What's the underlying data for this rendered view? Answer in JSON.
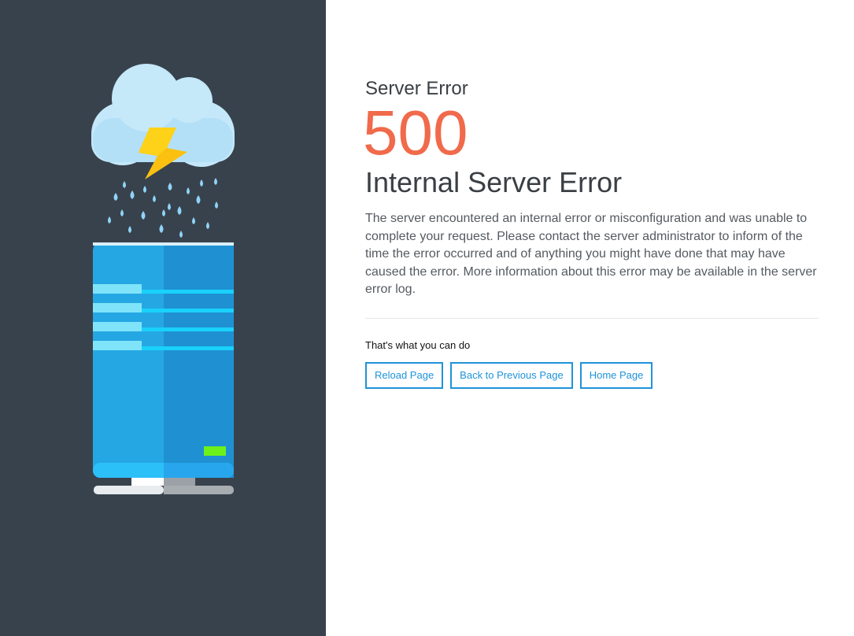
{
  "error": {
    "heading": "Server Error",
    "code": "500",
    "title": "Internal Server Error",
    "description": "The server encountered an internal error or misconfiguration and was unable to complete your request. Please contact the server administrator to inform of the time the error occurred and of anything you might have done that may have caused the error. More information about this error may be available in the server error log."
  },
  "actions": {
    "label": "That's what you can do",
    "buttons": [
      {
        "label": "Reload Page"
      },
      {
        "label": "Back to Previous Page"
      },
      {
        "label": "Home Page"
      }
    ]
  },
  "colors": {
    "sidebar_bg": "#38424d",
    "accent": "#1f93d8",
    "code": "#f06a4b",
    "status_light": "#6cf21a"
  },
  "illustration": {
    "icons": [
      "cloud-icon",
      "lightning-icon",
      "rain-icon",
      "server-icon"
    ]
  }
}
